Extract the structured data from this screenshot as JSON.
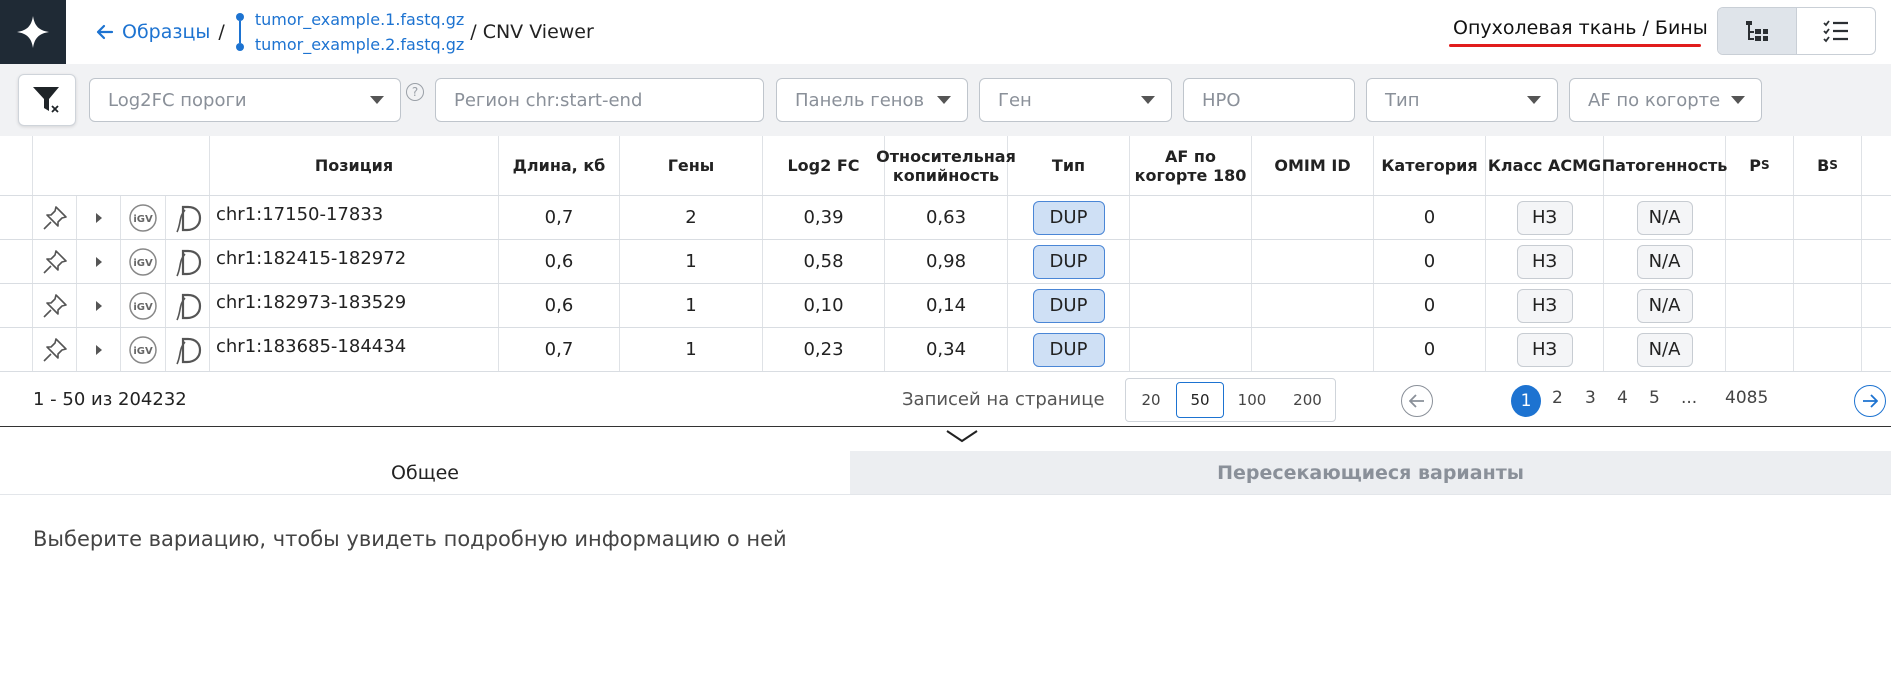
{
  "header": {
    "back_label": "Образцы",
    "separator": "/",
    "files": [
      "tumor_example.1.fastq.gz",
      "tumor_example.2.fastq.gz"
    ],
    "tail": "/ CNV Viewer",
    "mode_title": "Опухолевая ткань / Бины",
    "underline_color": "#e11c1c"
  },
  "filters": {
    "log2fc": "Log2FC пороги",
    "region": "Регион chr:start-end",
    "panel": "Панель генов",
    "gene": "Ген",
    "hpo": "HPO",
    "type": "Тип",
    "af": "AF по когорте",
    "help_glyph": "?"
  },
  "table": {
    "headers": {
      "position": "Позиция",
      "length": "Длина, кб",
      "genes": "Гены",
      "log2fc": "Log2 FC",
      "rel_copy": "Относительная копийность",
      "type": "Тип",
      "af": "AF по когорте 180",
      "omim": "OMIM ID",
      "category": "Категория",
      "acmg": "Класс ACMG",
      "patho": "Патогенность",
      "ps_main": "P",
      "ps_sub": "S",
      "bs_main": "B",
      "bs_sub": "S"
    },
    "rows": [
      {
        "position": "chr1:17150-17833",
        "length": "0,7",
        "genes": "2",
        "log2fc": "0,39",
        "rel_copy": "0,63",
        "type": "DUP",
        "af": "",
        "omim": "",
        "category": "0",
        "acmg": "НЗ",
        "patho": "N/A"
      },
      {
        "position": "chr1:182415-182972",
        "length": "0,6",
        "genes": "1",
        "log2fc": "0,58",
        "rel_copy": "0,98",
        "type": "DUP",
        "af": "",
        "omim": "",
        "category": "0",
        "acmg": "НЗ",
        "patho": "N/A"
      },
      {
        "position": "chr1:182973-183529",
        "length": "0,6",
        "genes": "1",
        "log2fc": "0,10",
        "rel_copy": "0,14",
        "type": "DUP",
        "af": "",
        "omim": "",
        "category": "0",
        "acmg": "НЗ",
        "patho": "N/A"
      },
      {
        "position": "chr1:183685-184434",
        "length": "0,7",
        "genes": "1",
        "log2fc": "0,23",
        "rel_copy": "0,34",
        "type": "DUP",
        "af": "",
        "omim": "",
        "category": "0",
        "acmg": "НЗ",
        "patho": "N/A"
      }
    ],
    "row_icons": [
      "pin-icon",
      "expand-caret-icon",
      "igv-icon",
      "decipher-icon"
    ]
  },
  "pagination": {
    "summary": "1 - 50 из 204232",
    "per_page_label": "Записей на странице",
    "per_page_options": [
      "20",
      "50",
      "100",
      "200"
    ],
    "per_page_selected": "50",
    "pages": [
      "1",
      "2",
      "3",
      "4",
      "5",
      "...",
      "4085"
    ],
    "current_page": "1"
  },
  "details": {
    "tabs": [
      "Общее",
      "Пересекающиеся варианты"
    ],
    "active_tab": "Общее",
    "hint": "Выберите вариацию, чтобы увидеть подробную информацию о ней"
  },
  "colors": {
    "accent": "#1d73d1",
    "logo_bg": "#1f2a35",
    "dup_fill": "#cfe0f5"
  }
}
